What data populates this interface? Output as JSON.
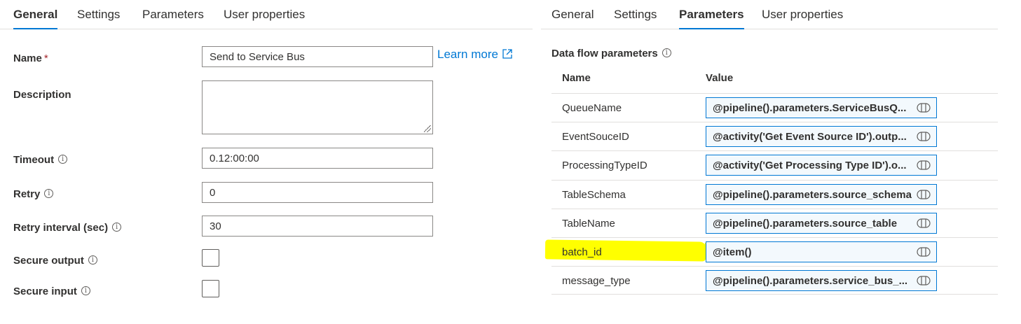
{
  "left_panel": {
    "tabs": [
      "General",
      "Settings",
      "Parameters",
      "User properties"
    ],
    "active_tab": "General",
    "fields": {
      "name_label": "Name",
      "required_mark": "*",
      "name_value": "Send to Service Bus",
      "learn_more": "Learn more",
      "description_label": "Description",
      "timeout_label": "Timeout",
      "timeout_value": "0.12:00:00",
      "retry_label": "Retry",
      "retry_value": "0",
      "retry_interval_label": "Retry interval (sec)",
      "retry_interval_value": "30",
      "secure_output_label": "Secure output",
      "secure_input_label": "Secure input"
    }
  },
  "right_panel": {
    "tabs": [
      "General",
      "Settings",
      "Parameters",
      "User properties"
    ],
    "active_tab": "Parameters",
    "section_title": "Data flow parameters",
    "columns": [
      "Name",
      "Value"
    ],
    "rows": [
      {
        "name": "QueueName",
        "value": "@pipeline().parameters.ServiceBusQ..."
      },
      {
        "name": "EventSouceID",
        "value": "@activity('Get Event Source ID').outp..."
      },
      {
        "name": "ProcessingTypeID",
        "value": "@activity('Get Processing Type ID').o..."
      },
      {
        "name": "TableSchema",
        "value": "@pipeline().parameters.source_schema"
      },
      {
        "name": "TableName",
        "value": "@pipeline().parameters.source_table"
      },
      {
        "name": "batch_id",
        "value": "@item()"
      },
      {
        "name": "message_type",
        "value": "@pipeline().parameters.service_bus_..."
      }
    ]
  },
  "icons": {
    "info": "info-icon",
    "external_link": "external-link-icon",
    "expression": "expression-icon"
  },
  "colors": {
    "accent": "#0078d4",
    "highlight": "#ffff00",
    "required": "#a4262c"
  }
}
